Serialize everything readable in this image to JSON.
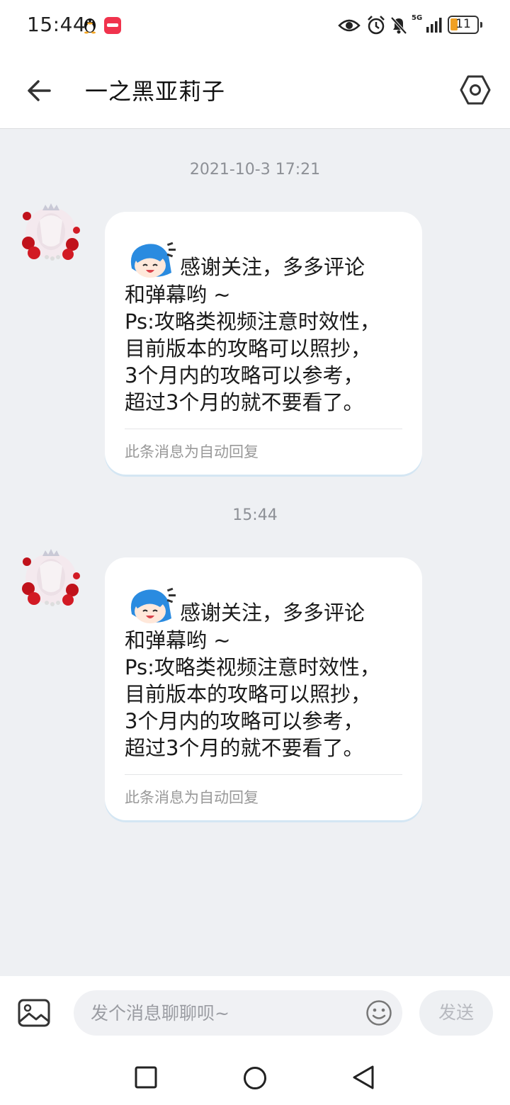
{
  "status_bar": {
    "time": "15:44",
    "network": "5G",
    "battery": "11",
    "icons": [
      "qq-penguin-icon",
      "app-badge-icon",
      "eye-icon",
      "alarm-icon",
      "mute-icon",
      "signal-icon",
      "battery-icon"
    ]
  },
  "header": {
    "title": "一之黑亚莉子",
    "back_icon": "arrow-left-icon",
    "settings_icon": "hexagon-settings-icon"
  },
  "messages": [
    {
      "timestamp": "2021-10-3 17:21",
      "sticker": "blue-girl-sticker-icon",
      "line1": "感谢关注，多多评论",
      "line2": "和弹幕哟 ~",
      "line3": "Ps:攻略类视频注意时效性，",
      "line4": "目前版本的攻略可以照抄，",
      "line5": "3个月内的攻略可以参考，",
      "line6": "超过3个月的就不要看了。",
      "footer": "此条消息为自动回复"
    },
    {
      "timestamp": "15:44",
      "sticker": "blue-girl-sticker-icon",
      "line1": "感谢关注，多多评论",
      "line2": "和弹幕哟 ~",
      "line3": "Ps:攻略类视频注意时效性，",
      "line4": "目前版本的攻略可以照抄，",
      "line5": "3个月内的攻略可以参考，",
      "line6": "超过3个月的就不要看了。",
      "footer": "此条消息为自动回复"
    }
  ],
  "input_bar": {
    "placeholder": "发个消息聊聊呗~",
    "send_label": "发送",
    "image_icon": "image-icon",
    "emoji_icon": "emoji-icon"
  },
  "nav_bar": {
    "icons": [
      "square-recents-icon",
      "circle-home-icon",
      "triangle-back-icon"
    ]
  },
  "colors": {
    "background": "#eef0f3",
    "bubble": "#ffffff",
    "battery_fill": "#f0a023",
    "app_badge": "#f0334d",
    "muted_text": "#999999"
  }
}
